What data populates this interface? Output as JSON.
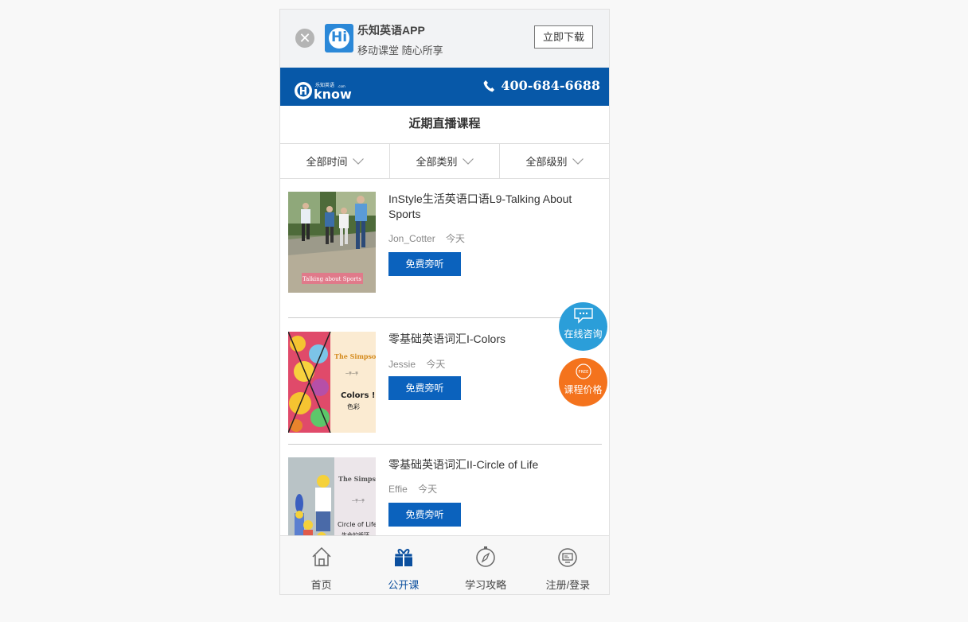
{
  "app_banner": {
    "close_glyph": "✕",
    "logo_letter": "Hi",
    "app_name": "乐知英语APP",
    "tagline": "移动课堂 随心所享",
    "download_label": "立即下载"
  },
  "header": {
    "logo_text": "know",
    "logo_small_text": "乐知英语",
    "logo_tld": ".com",
    "phone": "400-684-6688"
  },
  "page_title": "近期直播课程",
  "filters": [
    {
      "label": "全部时间"
    },
    {
      "label": "全部类别"
    },
    {
      "label": "全部级别"
    }
  ],
  "courses": [
    {
      "title": "InStyle生活英语口语L9-Talking About Sports",
      "teacher": "Jon_Cotter",
      "date": "今天",
      "action": "免费旁听",
      "thumb_caption": "Talking about Sports"
    },
    {
      "title": "零基础英语词汇I-Colors",
      "teacher": "Jessie",
      "date": "今天",
      "action": "免费旁听",
      "thumb_series": "The Simpsons",
      "thumb_sub": "一手一手",
      "thumb_topic": "Colors !",
      "thumb_topic_cn": "色彩"
    },
    {
      "title": "零基础英语词汇II-Circle of Life",
      "teacher": "Effie",
      "date": "今天",
      "action": "免费旁听",
      "thumb_series": "The Simpsons",
      "thumb_sub": "一手一手",
      "thumb_topic": "Circle of Life",
      "thumb_topic_cn": "生命的循环"
    }
  ],
  "float_buttons": {
    "consult_label": "在线咨询",
    "price_label": "课程价格",
    "price_badge": "FREE"
  },
  "tabbar": [
    {
      "label": "首页",
      "icon": "home-icon"
    },
    {
      "label": "公开课",
      "icon": "gift-icon",
      "active": true
    },
    {
      "label": "学习攻略",
      "icon": "compass-icon"
    },
    {
      "label": "注册/登录",
      "icon": "user-icon"
    }
  ],
  "colors": {
    "brand_blue": "#0758a8",
    "button_blue": "#0b62bd",
    "consult_blue": "#2b9ed9",
    "price_orange": "#f4731d"
  }
}
